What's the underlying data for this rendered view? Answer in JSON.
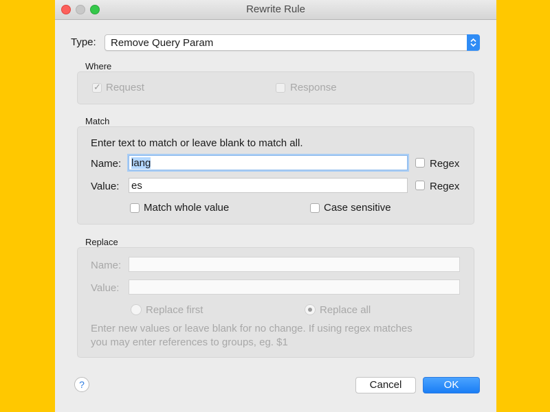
{
  "window": {
    "title": "Rewrite Rule"
  },
  "type": {
    "label": "Type:",
    "value": "Remove Query Param"
  },
  "where": {
    "label": "Where",
    "request": {
      "label": "Request",
      "checked": true
    },
    "response": {
      "label": "Response",
      "checked": false
    }
  },
  "match": {
    "label": "Match",
    "hint": "Enter text to match or leave blank to match all.",
    "name_label": "Name:",
    "name_value": "lang",
    "value_label": "Value:",
    "value_value": "es",
    "regex_label": "Regex",
    "match_whole_label": "Match whole value",
    "case_sensitive_label": "Case sensitive"
  },
  "replace": {
    "label": "Replace",
    "name_label": "Name:",
    "value_label": "Value:",
    "replace_first_label": "Replace first",
    "replace_all_label": "Replace all",
    "selected": "Replace all",
    "hint_line1": "Enter new values or leave blank for no change. If using regex matches",
    "hint_line2": "you may enter references to groups, eg. $1"
  },
  "buttons": {
    "help": "?",
    "cancel": "Cancel",
    "ok": "OK"
  },
  "colors": {
    "accent": "#2f8cf5",
    "background": "#ffc800",
    "dialog": "#ececec"
  }
}
